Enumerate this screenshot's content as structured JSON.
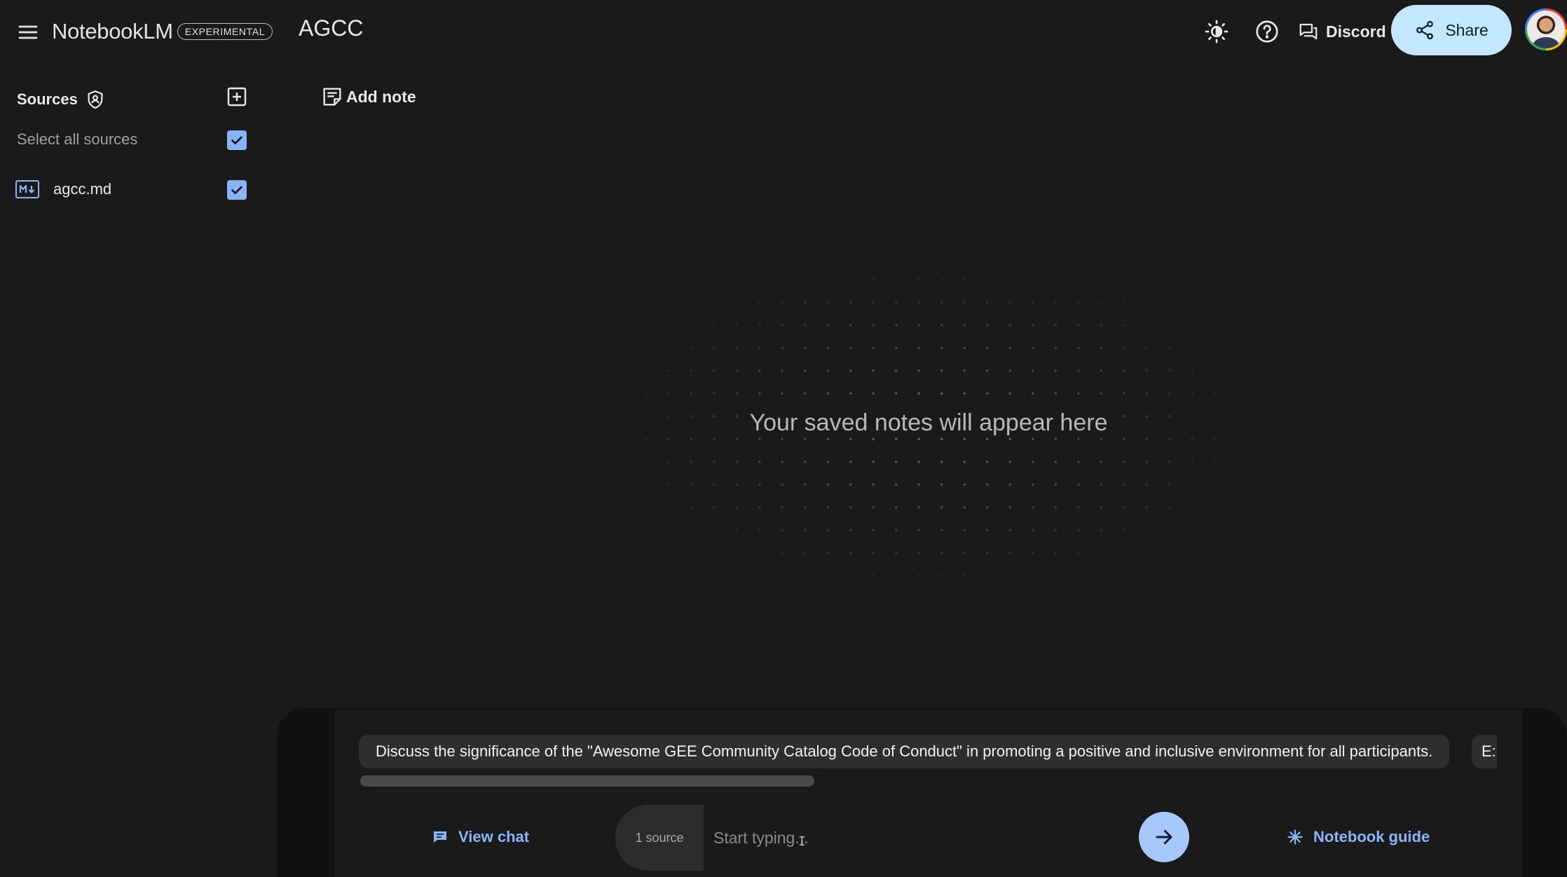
{
  "header": {
    "brand": "NotebookLM",
    "badge": "EXPERIMENTAL",
    "notebook_title": "AGCC",
    "discord_label": "Discord",
    "share_label": "Share"
  },
  "sources": {
    "title": "Sources",
    "select_all_label": "Select all sources",
    "select_all_checked": true,
    "items": [
      {
        "name": "agcc.md",
        "type_icon": "markdown-icon",
        "checked": true
      }
    ]
  },
  "notes": {
    "add_note_label": "Add note",
    "empty_message": "Your saved notes will appear here"
  },
  "chat": {
    "suggestions": [
      "Discuss the significance of the \"Awesome GEE Community Catalog Code of Conduct\" in promoting a positive and inclusive environment for all participants.",
      "E:"
    ],
    "view_chat_label": "View chat",
    "source_count_label": "1 source",
    "input_placeholder": "Start typing...",
    "notebook_guide_label": "Notebook guide"
  },
  "colors": {
    "background": "#1a1a1a",
    "accent": "#8ab4f8",
    "share_bg": "#c2e7ff",
    "send_bg": "#a8c7fa",
    "chip_bg": "#2e2e2e"
  }
}
